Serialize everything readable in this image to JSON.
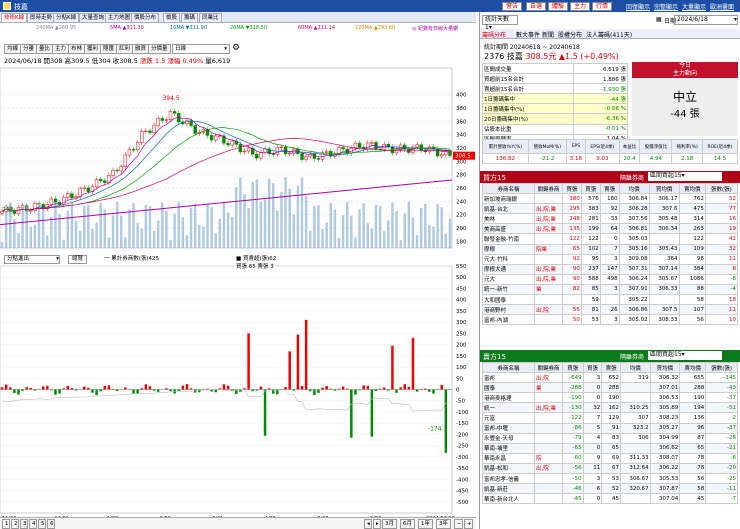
{
  "window": {
    "title": "技嘉",
    "buttons": [
      "警告",
      "自選",
      "體驗",
      "主力",
      "行情"
    ],
    "links": [
      "回復顯示",
      "完整顯示",
      "大量顯示",
      "歐洲畫面"
    ]
  },
  "tabs": [
    "技術K線",
    "即時走勢",
    "分點K線",
    "大量查詢",
    "主力地圖",
    "價股分布",
    "檢股",
    "籌碼",
    "同業比"
  ],
  "legend": [
    "5MA ▲311.30",
    "10MA ▼311.90",
    "20MA ▼318.50",
    "60MA ▲311.14",
    "120MA ▲293.60",
    "240MA ▲260.95"
  ],
  "legend_note": "◎ 紀錄有日線大量鑽",
  "toolbar": [
    "均線",
    "分量",
    "量比",
    "主力",
    "布林",
    "獲利",
    "隱匯",
    "紅利",
    "融資",
    "分價量"
  ],
  "period_select": "日線",
  "info": {
    "date": "2024/06/18",
    "open_label": "開",
    "open": "308",
    "high_label": "高",
    "high": "309.5",
    "low_label": "低",
    "low": "304",
    "close_label": "收",
    "close": "308.5",
    "change": "漲跌 1.5",
    "pct": "漲幅 0.49%",
    "vol_label": "量",
    "vol": "6,619"
  },
  "price_axis": [
    "400",
    "380",
    "360",
    "340",
    "320",
    "300",
    "280",
    "260",
    "240",
    "220",
    "200",
    "180"
  ],
  "lower_axis": [
    "550",
    "500",
    "450",
    "400",
    "350",
    "300",
    "250",
    "200",
    "150",
    "100",
    "50",
    "0",
    "-50",
    "-100",
    "-150",
    "-200",
    "-250",
    "-300",
    "-350",
    "-400",
    "-450",
    "-500"
  ],
  "peak_label": "394.5",
  "low_label_chart": "213",
  "lower_select": "分點進出",
  "lower_btn": "總覽",
  "lower_legend": [
    "一 累計券商數(張)425",
    "■ 買賣超(張)62"
  ],
  "lower_sub": "買張 65 賣張 3",
  "last_value": "-174.1",
  "dates": [
    "11/03",
    "12/01",
    "1/02",
    "2/01",
    "3/01",
    "4/01",
    "5/02",
    "6/03",
    "2024/06/18"
  ],
  "year_labels": [
    "2023",
    "2024"
  ],
  "pager": [
    "1",
    "2",
    "3",
    "4",
    "5",
    "6"
  ],
  "range_btns": [
    "3月",
    "6月",
    "1年",
    "3年"
  ],
  "right": {
    "stats_tab": "統計天數",
    "stats_val": "1",
    "range_label": "日期",
    "date_val": "2024/6/18",
    "subtabs": [
      "籌碼分布",
      "數大事件",
      "新聞",
      "股權分布",
      "法人籌碼(411天)"
    ],
    "stat_hdr": "統計期間 20240618 ~ 20240618",
    "stock_line": {
      "name": "2376 技嘉",
      "price": "308.5元",
      "chg": "▲1.5 (+0.49%)"
    },
    "rows": [
      {
        "k": "區間成交量",
        "v": "6,619 張"
      },
      {
        "k": "買超前15名合計",
        "v": "1,886 張"
      },
      {
        "k": "賣超前15名合計",
        "v": "-1,930 張"
      },
      {
        "k": "1日籌碼集中",
        "v": "-44 張"
      },
      {
        "k": "1日籌碼集中(%)",
        "v": "-0.66 %"
      },
      {
        "k": "20日籌碼集中(%)",
        "v": "-6.36 %"
      },
      {
        "k": "佔股本比重",
        "v": "-0.01 %"
      },
      {
        "k": "區間周轉率",
        "v": "1.04 %"
      }
    ],
    "today_hdr": "今日",
    "main_dir": "主力動向",
    "neutral": "中立",
    "neutral_val": "-44 張",
    "fin_heads": [
      "累計營收YoY(%)",
      "營收MoM(%)",
      "EPS",
      "EPS(近4季)",
      "本益比",
      "股價淨值比",
      "殖利率(%)",
      "ROE(近4季)"
    ],
    "fin_vals": [
      "136.82",
      "-21.2",
      "3.18",
      "9.03",
      "20.4",
      "4.94",
      "2.18",
      "14.5"
    ],
    "buy_title": "買方15",
    "sell_title": "賣方15",
    "rank_label": "隔離券商",
    "rank_select": "區間買超15",
    "table_heads": [
      "券商名稱",
      "關鍵券商",
      "買張",
      "賣張",
      "均價",
      "買均價",
      "賣均價",
      "張數(張)"
    ],
    "buy": [
      [
        "新加坡商瑞銀",
        "",
        "380",
        "576",
        "180",
        "306.84",
        "306.17",
        "762",
        "52"
      ],
      [
        "凱基-台北",
        "出,院,業",
        "295",
        "383",
        "92",
        "306.28",
        "307.6",
        "475",
        "77"
      ],
      [
        "美林",
        "出,院,業",
        "248",
        "281",
        "33",
        "307.56",
        "305.48",
        "314",
        "16"
      ],
      [
        "美商高盛",
        "出,院,業",
        "135",
        "199",
        "64",
        "306.81",
        "306.34",
        "263",
        "19"
      ],
      [
        "聯發金融-竹南",
        "",
        "122",
        "122",
        "0",
        "305.03",
        "",
        "122",
        "42"
      ],
      [
        "摩根",
        "院業",
        "65",
        "102",
        "7",
        "305.16",
        "305.43",
        "109",
        "32"
      ],
      [
        "元大-竹科",
        "",
        "92",
        "95",
        "3",
        "309.08",
        "364",
        "98",
        "11"
      ],
      [
        "摩根大通",
        "出,院,業",
        "90",
        "237",
        "147",
        "307.31",
        "307.14",
        "384",
        "8"
      ],
      [
        "元大",
        "出,院,業",
        "90",
        "588",
        "498",
        "306.24",
        "305.67",
        "1086",
        "-8"
      ],
      [
        "統一-新竹",
        "業",
        "82",
        "85",
        "3",
        "307.91",
        "306.33",
        "88",
        "-4"
      ],
      [
        "大和國泰",
        "",
        "",
        "59",
        "",
        "305.22",
        "",
        "58",
        "18"
      ],
      [
        "港商野村",
        "出,院",
        "55",
        "81",
        "26",
        "306.86",
        "307.5",
        "107",
        "11"
      ],
      [
        "富邦-內湖",
        "",
        "50",
        "53",
        "3",
        "305.02",
        "308.33",
        "56",
        "10"
      ]
    ],
    "sell": [
      [
        "富邦",
        "出,院",
        "-649",
        "3",
        "652",
        "319",
        "306.32",
        "655",
        "-145"
      ],
      [
        "國泰",
        "業",
        "-288",
        "0",
        "288",
        "",
        "307.01",
        "288",
        "-43"
      ],
      [
        "港商麥格理",
        "",
        "-190",
        "0",
        "190",
        "",
        "306.53",
        "190",
        "-37"
      ],
      [
        "統一",
        "出,院,業",
        "-130",
        "32",
        "162",
        "310.25",
        "305.89",
        "194",
        "-51"
      ],
      [
        "元富",
        "",
        "-122",
        "7",
        "129",
        "307",
        "308.23",
        "136",
        "-2"
      ],
      [
        "富邦-中壢",
        "",
        "-86",
        "5",
        "91",
        "323.2",
        "305.27",
        "96",
        "-37"
      ],
      [
        "永豐金-天母",
        "",
        "-79",
        "4",
        "83",
        "306",
        "304.99",
        "87",
        "-28"
      ],
      [
        "華南-埔里",
        "",
        "-65",
        "0",
        "65",
        "",
        "306.62",
        "65",
        "-21"
      ],
      [
        "華南永昌",
        "院",
        "-60",
        "9",
        "69",
        "311.33",
        "308.07",
        "78",
        "-6"
      ],
      [
        "凱基-松和",
        "出,院",
        "-56",
        "11",
        "67",
        "312.64",
        "306.22",
        "78",
        "-20"
      ],
      [
        "富邦忠孝-信義",
        "",
        "-50",
        "3",
        "53",
        "306.67",
        "305.53",
        "56",
        "-25"
      ],
      [
        "凱基-新莊",
        "",
        "-46",
        "6",
        "52",
        "320.67",
        "307.87",
        "58",
        "-11"
      ],
      [
        "華南-新台北人",
        "",
        "-45",
        "0",
        "45",
        "",
        "307.04",
        "45",
        "-7"
      ]
    ]
  },
  "chart_data": {
    "type": "candlestick",
    "title": "",
    "xlabel": "",
    "ylabel": "",
    "ylim": [
      170,
      440
    ],
    "x": [
      "2023/11/03",
      "2023/12/01",
      "2024/01/02",
      "2024/02/01",
      "2024/03/01",
      "2024/04/01",
      "2024/05/02",
      "2024/06/03",
      "2024/06/18"
    ],
    "close_series": {
      "name": "",
      "values": [
        225,
        230,
        240,
        258,
        282,
        340,
        372,
        345,
        330,
        310,
        318,
        305,
        315,
        325,
        318,
        320,
        308.5
      ]
    },
    "lower_bars": {
      "ylim": [
        -550,
        550
      ]
    }
  }
}
